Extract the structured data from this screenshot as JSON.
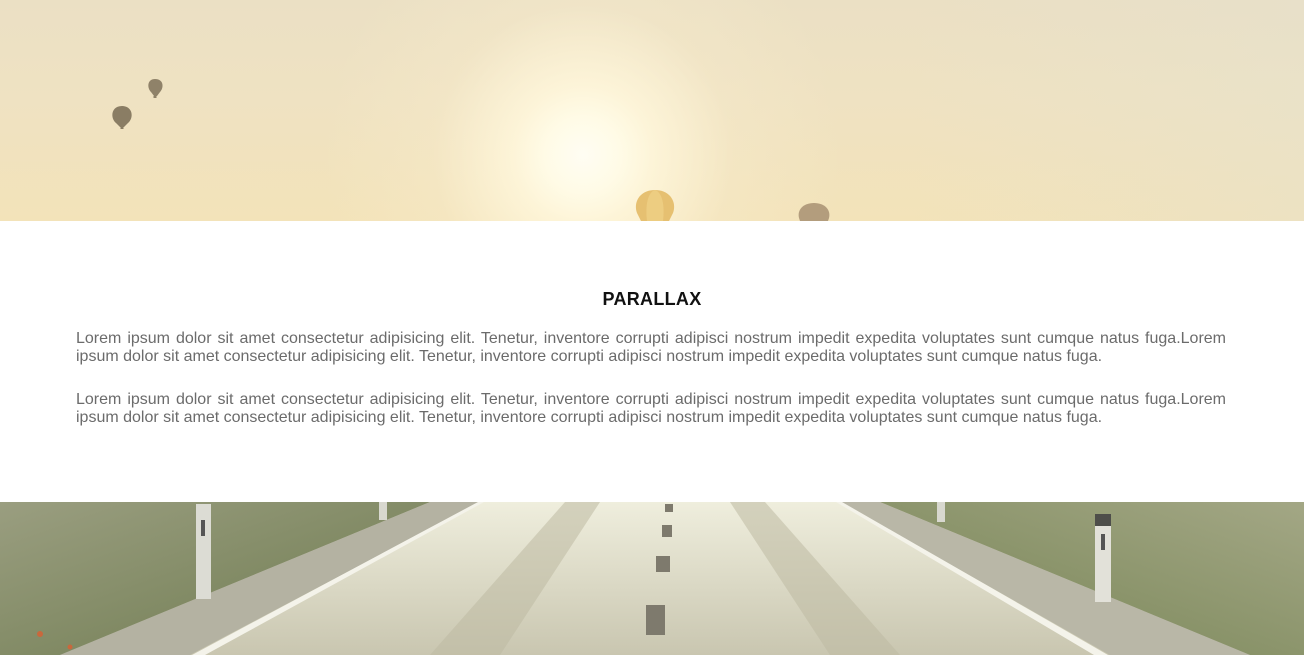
{
  "section": {
    "title": "PARALLAX",
    "paragraphs": [
      "Lorem ipsum dolor sit amet consectetur adipisicing elit. Tenetur, inventore corrupti adipisci nostrum impedit expedita voluptates sunt cumque natus fuga.Lorem ipsum dolor sit amet consectetur adipisicing elit. Tenetur, inventore corrupti adipisci nostrum impedit expedita voluptates sunt cumque natus fuga.",
      "Lorem ipsum dolor sit amet consectetur adipisicing elit. Tenetur, inventore corrupti adipisci nostrum impedit expedita voluptates sunt cumque natus fuga.Lorem ipsum dolor sit amet consectetur adipisicing elit. Tenetur, inventore corrupti adipisci nostrum impedit expedita voluptates sunt cumque natus fuga."
    ]
  },
  "images": {
    "top": "sunrise-sky-with-hot-air-balloons",
    "bottom": "empty-country-road"
  },
  "colors": {
    "heading": "#111111",
    "body_text": "#6b6b6b",
    "background": "#ffffff"
  }
}
